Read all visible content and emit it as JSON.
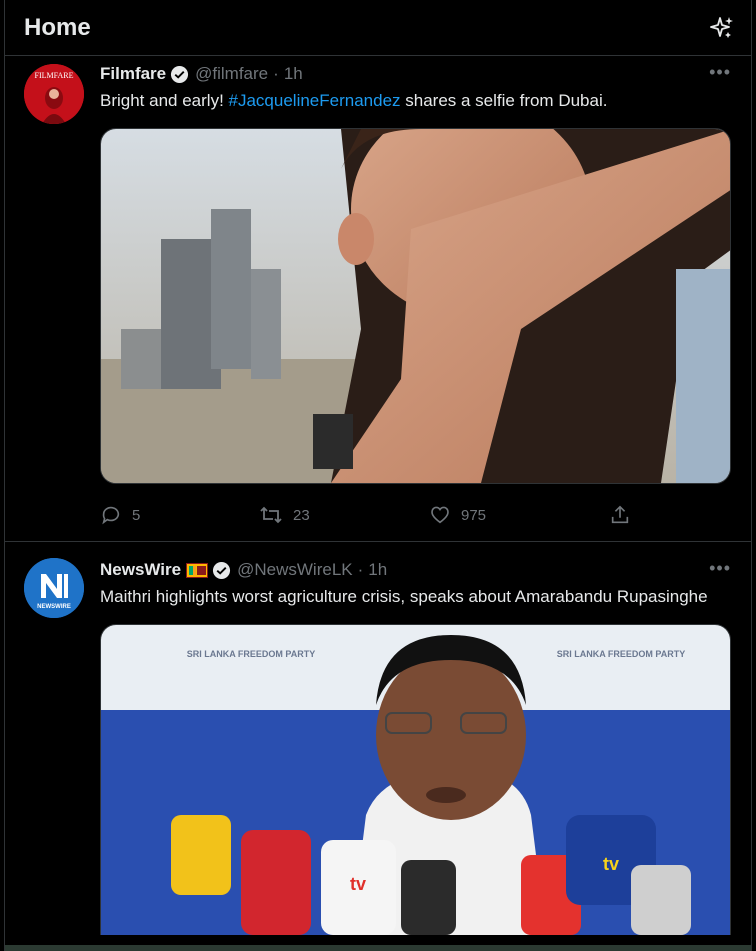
{
  "header": {
    "title": "Home"
  },
  "tweets": [
    {
      "name": "Filmfare",
      "handle": "@filmfare",
      "time": "1h",
      "text_before": "Bright and early! ",
      "hashtag": "#JacquelineFernandez",
      "text_after": " shares a selfie from Dubai.",
      "avatar_label": "FILMFARE",
      "stats": {
        "replies": "5",
        "retweets": "23",
        "likes": "975"
      }
    },
    {
      "name": "NewsWire",
      "handle": "@NewsWireLK",
      "time": "1h",
      "text": "Maithri highlights worst agriculture crisis, speaks about Amarabandu Rupasinghe",
      "avatar_label": "NEWSWIRE",
      "backdrop_text": "SRI LANKA FREEDOM PARTY",
      "mic_labels": [
        "tv",
        "tv"
      ]
    }
  ],
  "colors": {
    "accent": "#1d9bf0",
    "muted": "#71767b",
    "text": "#e7e9ea"
  }
}
